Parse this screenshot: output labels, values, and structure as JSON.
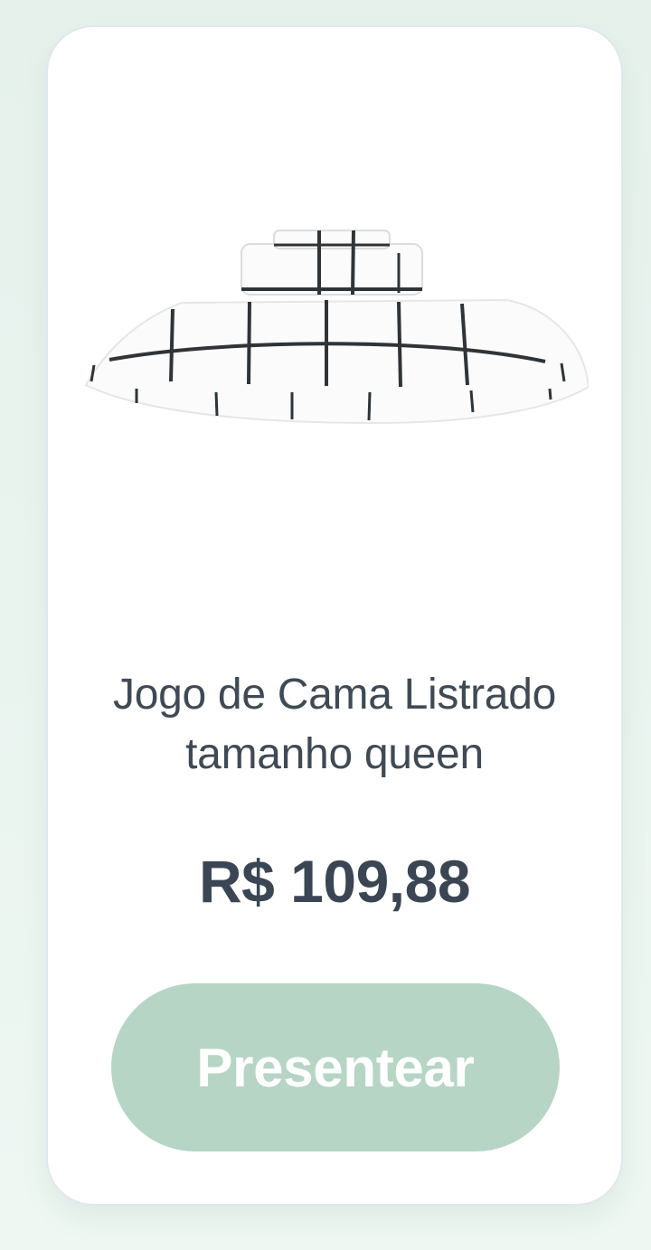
{
  "product": {
    "image_icon": "striped-bedding-set-icon",
    "title_line1": "Jogo de Cama Listrado",
    "title_line2": "tamanho queen",
    "price": "R$ 109,88",
    "button_label": "Presentear"
  },
  "colors": {
    "accent": "#b6d5c5",
    "text": "#3f4a55",
    "background": "#e8f3ee",
    "card": "#ffffff"
  }
}
